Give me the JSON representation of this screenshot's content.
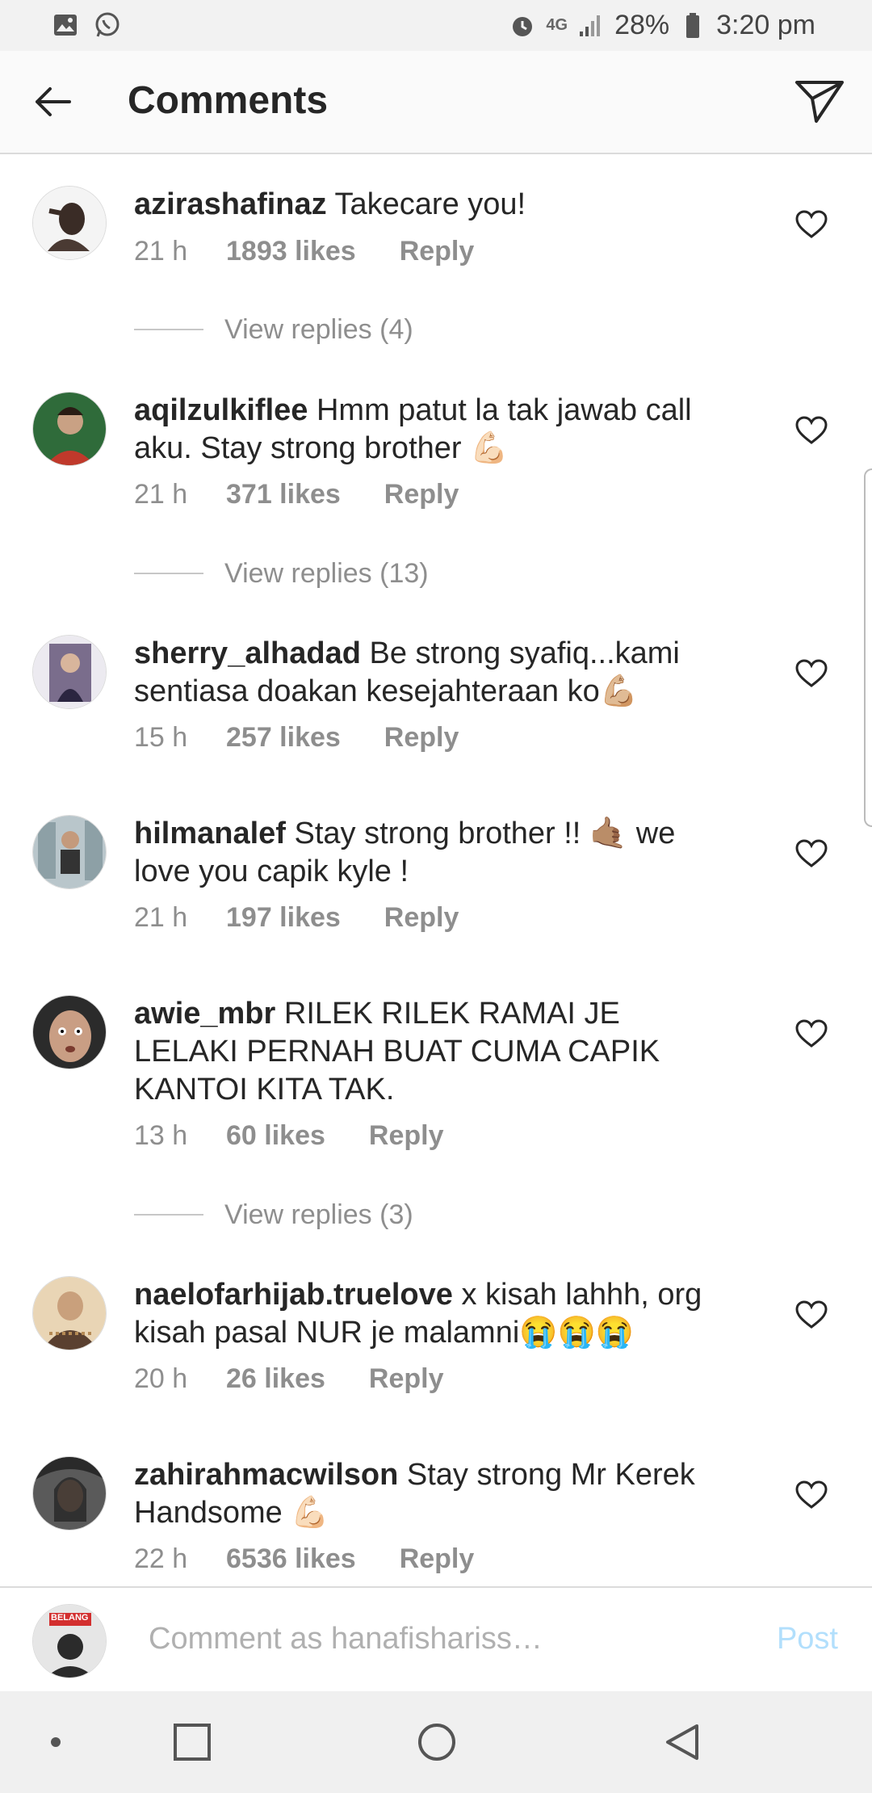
{
  "status_bar": {
    "network": "4G",
    "battery": "28%",
    "time": "3:20 pm",
    "icons": [
      "gallery-icon",
      "whatsapp-icon",
      "alarm-icon",
      "signal-icon",
      "battery-icon"
    ]
  },
  "header": {
    "title": "Comments",
    "back_icon": "arrow-left-icon",
    "share_icon": "send-icon"
  },
  "comments": [
    {
      "user": "azirashafinaz",
      "text": "Takecare you!",
      "time": "21 h",
      "likes": "1893 likes",
      "reply": "Reply",
      "avatar_color": "#cfcfcf"
    },
    {
      "user": "aqilzulkiflee",
      "text": "Hmm patut la tak jawab call aku. Stay strong brother 💪🏻",
      "time": "21 h",
      "likes": "371 likes",
      "reply": "Reply",
      "avatar_color": "#2f6b3a"
    },
    {
      "user": "sherry_alhadad",
      "text": "Be strong syafiq...kami sentiasa doakan kesejahteraan ko💪🏼",
      "time": "15 h",
      "likes": "257 likes",
      "reply": "Reply",
      "avatar_color": "#7a6d8c"
    },
    {
      "user": "hilmanalef",
      "text": "Stay strong brother !! 🤙🏽  we love you capik kyle !",
      "time": "21 h",
      "likes": "197 likes",
      "reply": "Reply",
      "avatar_color": "#8da0a6"
    },
    {
      "user": "awie_mbr",
      "text": "RILEK RILEK RAMAI JE LELAKI PERNAH BUAT CUMA CAPIK KANTOI KITA TAK.",
      "time": "13 h",
      "likes": "60 likes",
      "reply": "Reply",
      "avatar_color": "#2b2b2b"
    },
    {
      "user": "naelofarhijab.truelove",
      "text": "x kisah lahhh,  org kisah pasal NUR je malamni😭😭😭",
      "time": "20 h",
      "likes": "26 likes",
      "reply": "Reply",
      "avatar_color": "#b58a55"
    },
    {
      "user": "zahirahmacwilson",
      "text": "Stay strong Mr Kerek Handsome 💪🏻",
      "time": "22 h",
      "likes": "6536 likes",
      "reply": "Reply",
      "avatar_color": "#3c3c3c"
    }
  ],
  "view_replies": [
    "View replies (4)",
    "View replies (13)",
    "View replies (3)"
  ],
  "composer": {
    "placeholder": "Comment as hanafishariss…",
    "post_label": "Post",
    "avatar_badge": "BELANG"
  },
  "colors": {
    "accent_disabled": "#b2dffc",
    "secondary_text": "#8e8e8e",
    "primary_text": "#262626"
  }
}
